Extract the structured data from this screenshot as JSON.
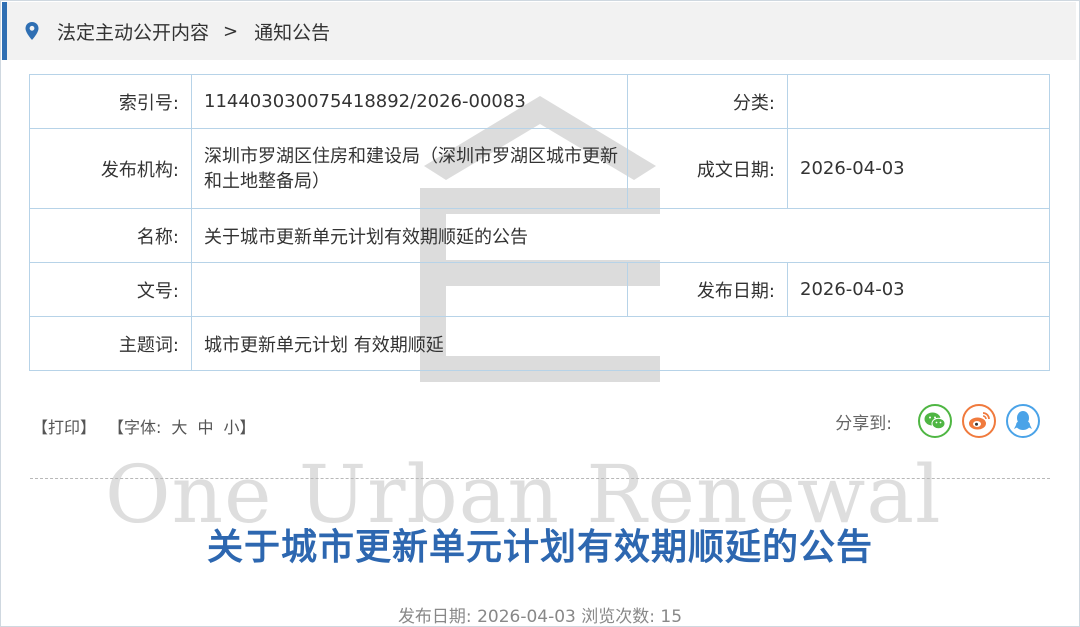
{
  "breadcrumb": {
    "items": [
      "法定主动公开内容",
      "通知公告"
    ],
    "separator": ">"
  },
  "info": {
    "index_label": "索引号:",
    "index_value": "11440303007541889​2/2026-00083",
    "category_label": "分类:",
    "category_value": "",
    "publisher_label": "发布机构:",
    "publisher_value": "深圳市罗湖区住房和建设局（深圳市罗湖区城市更新和土地整备局）",
    "written_date_label": "成文日期:",
    "written_date_value": "2026-04-03",
    "name_label": "名称:",
    "name_value": "关于城市更新单元计划有效期顺延的公告",
    "doc_no_label": "文号:",
    "doc_no_value": "",
    "publish_date_label": "发布日期:",
    "publish_date_value": "2026-04-03",
    "keywords_label": "主题词:",
    "keywords_value": "城市更新单元计划 有效期顺延"
  },
  "tools": {
    "print": "【打印】",
    "font_prefix": "【字体:",
    "font_large": "大",
    "font_medium": "中",
    "font_small": "小",
    "font_suffix": "】"
  },
  "share": {
    "label": "分享到:",
    "icons": [
      "wechat-icon",
      "weibo-icon",
      "qq-icon"
    ]
  },
  "watermark": {
    "text": "One Urban Renewal"
  },
  "article": {
    "title": "关于城市更新单元计划有效期顺延的公告",
    "meta": "发布日期:  2026-04-03  浏览次数:  15"
  },
  "colors": {
    "accent": "#2f6fb3",
    "title": "#2d67b0",
    "table_border": "#b7d3e8",
    "wechat": "#4fb643",
    "weibo": "#f07a3d",
    "qq": "#4aa3e8"
  }
}
